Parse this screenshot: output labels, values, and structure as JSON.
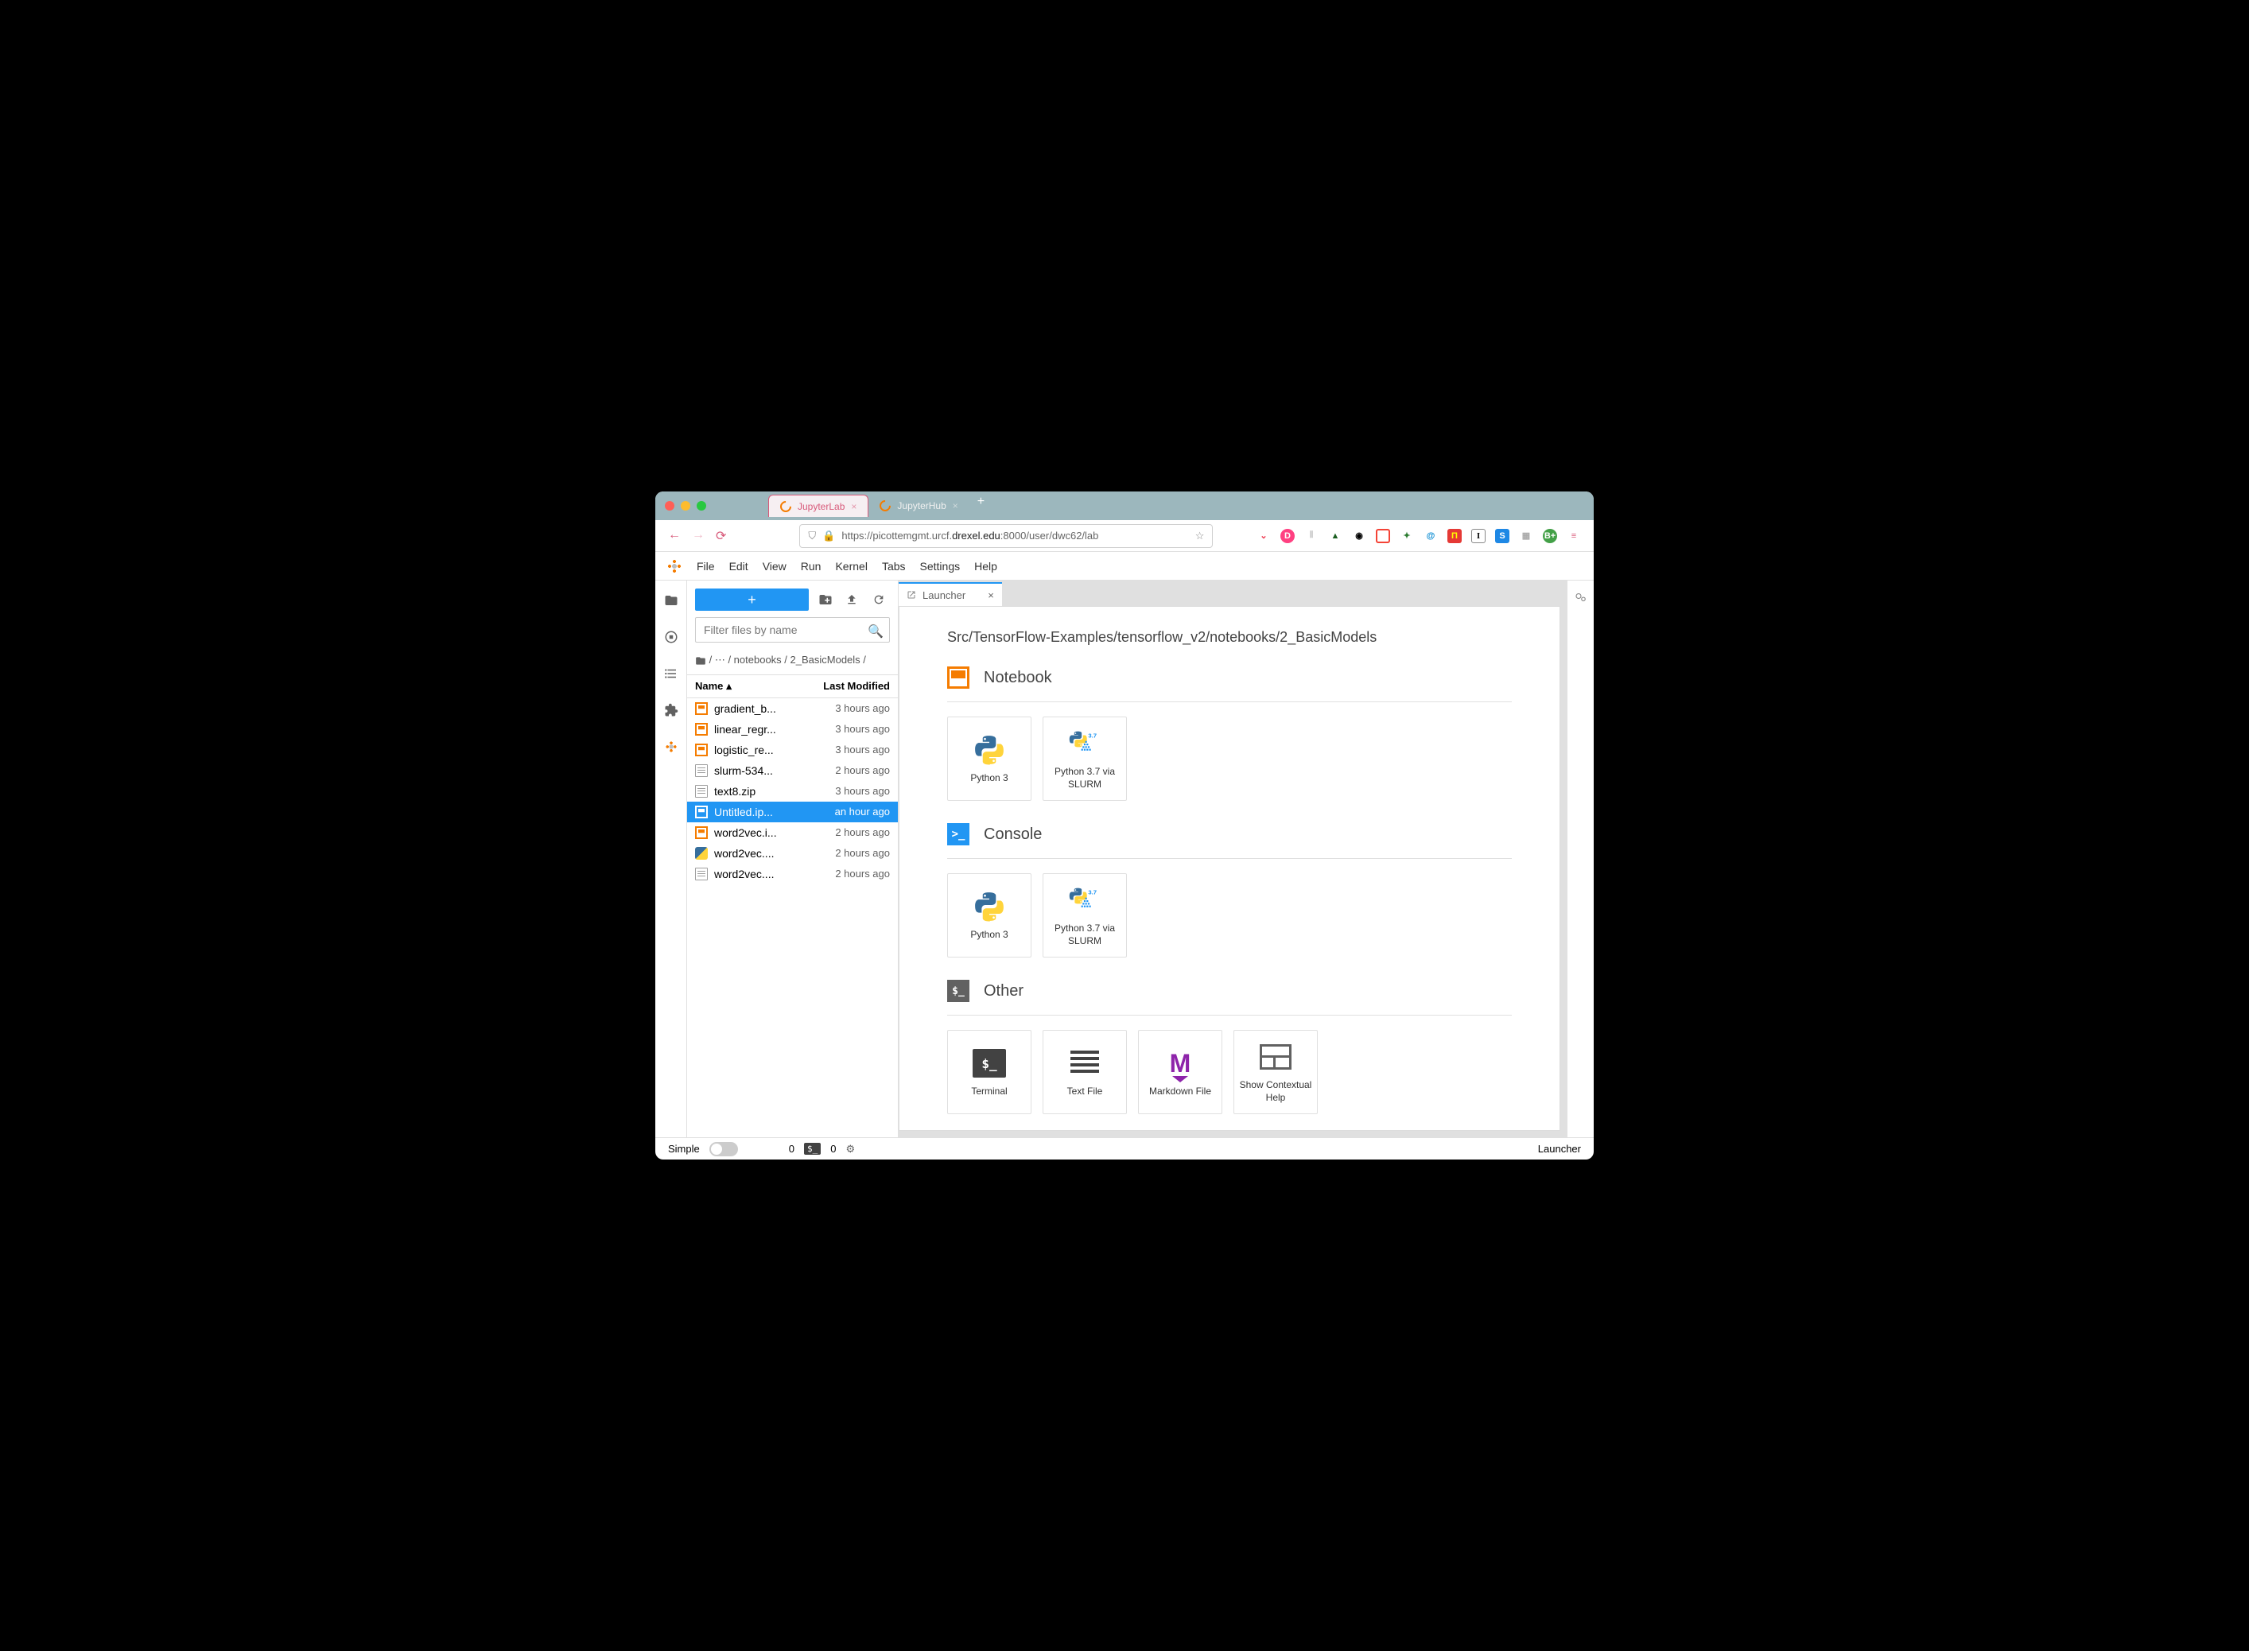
{
  "browser": {
    "tabs": [
      {
        "label": "JupyterLab",
        "active": true
      },
      {
        "label": "JupyterHub",
        "active": false
      }
    ],
    "url_prefix": "https://picottemgmt.urcf.",
    "url_domain": "drexel.edu",
    "url_suffix": ":8000/user/dwc62/lab"
  },
  "menubar": [
    "File",
    "Edit",
    "View",
    "Run",
    "Kernel",
    "Tabs",
    "Settings",
    "Help"
  ],
  "filebrowser": {
    "filter_placeholder": "Filter files by name",
    "crumbs": "/ ⋯ / notebooks / 2_BasicModels /",
    "col_name": "Name",
    "col_modified": "Last Modified",
    "files": [
      {
        "icon": "nb",
        "name": "gradient_b...",
        "time": "3 hours ago",
        "selected": false
      },
      {
        "icon": "nb",
        "name": "linear_regr...",
        "time": "3 hours ago",
        "selected": false
      },
      {
        "icon": "nb",
        "name": "logistic_re...",
        "time": "3 hours ago",
        "selected": false
      },
      {
        "icon": "file",
        "name": "slurm-534...",
        "time": "2 hours ago",
        "selected": false
      },
      {
        "icon": "file",
        "name": "text8.zip",
        "time": "3 hours ago",
        "selected": false
      },
      {
        "icon": "nb",
        "name": "Untitled.ip...",
        "time": "an hour ago",
        "selected": true
      },
      {
        "icon": "nb",
        "name": "word2vec.i...",
        "time": "2 hours ago",
        "selected": false
      },
      {
        "icon": "py",
        "name": "word2vec....",
        "time": "2 hours ago",
        "selected": false
      },
      {
        "icon": "file",
        "name": "word2vec....",
        "time": "2 hours ago",
        "selected": false
      }
    ]
  },
  "launcher": {
    "tab_label": "Launcher",
    "path": "Src/TensorFlow-Examples/tensorflow_v2/notebooks/2_BasicModels",
    "sections": {
      "notebook": {
        "title": "Notebook",
        "cards": [
          {
            "label": "Python 3",
            "kind": "python"
          },
          {
            "label": "Python 3.7 via SLURM",
            "kind": "python37"
          }
        ]
      },
      "console": {
        "title": "Console",
        "cards": [
          {
            "label": "Python 3",
            "kind": "python"
          },
          {
            "label": "Python 3.7 via SLURM",
            "kind": "python37"
          }
        ]
      },
      "other": {
        "title": "Other",
        "cards": [
          {
            "label": "Terminal",
            "kind": "terminal"
          },
          {
            "label": "Text File",
            "kind": "text"
          },
          {
            "label": "Markdown File",
            "kind": "markdown"
          },
          {
            "label": "Show Contextual Help",
            "kind": "ctx"
          }
        ]
      }
    }
  },
  "statusbar": {
    "simple_label": "Simple",
    "count1": "0",
    "count2": "0",
    "right": "Launcher"
  }
}
